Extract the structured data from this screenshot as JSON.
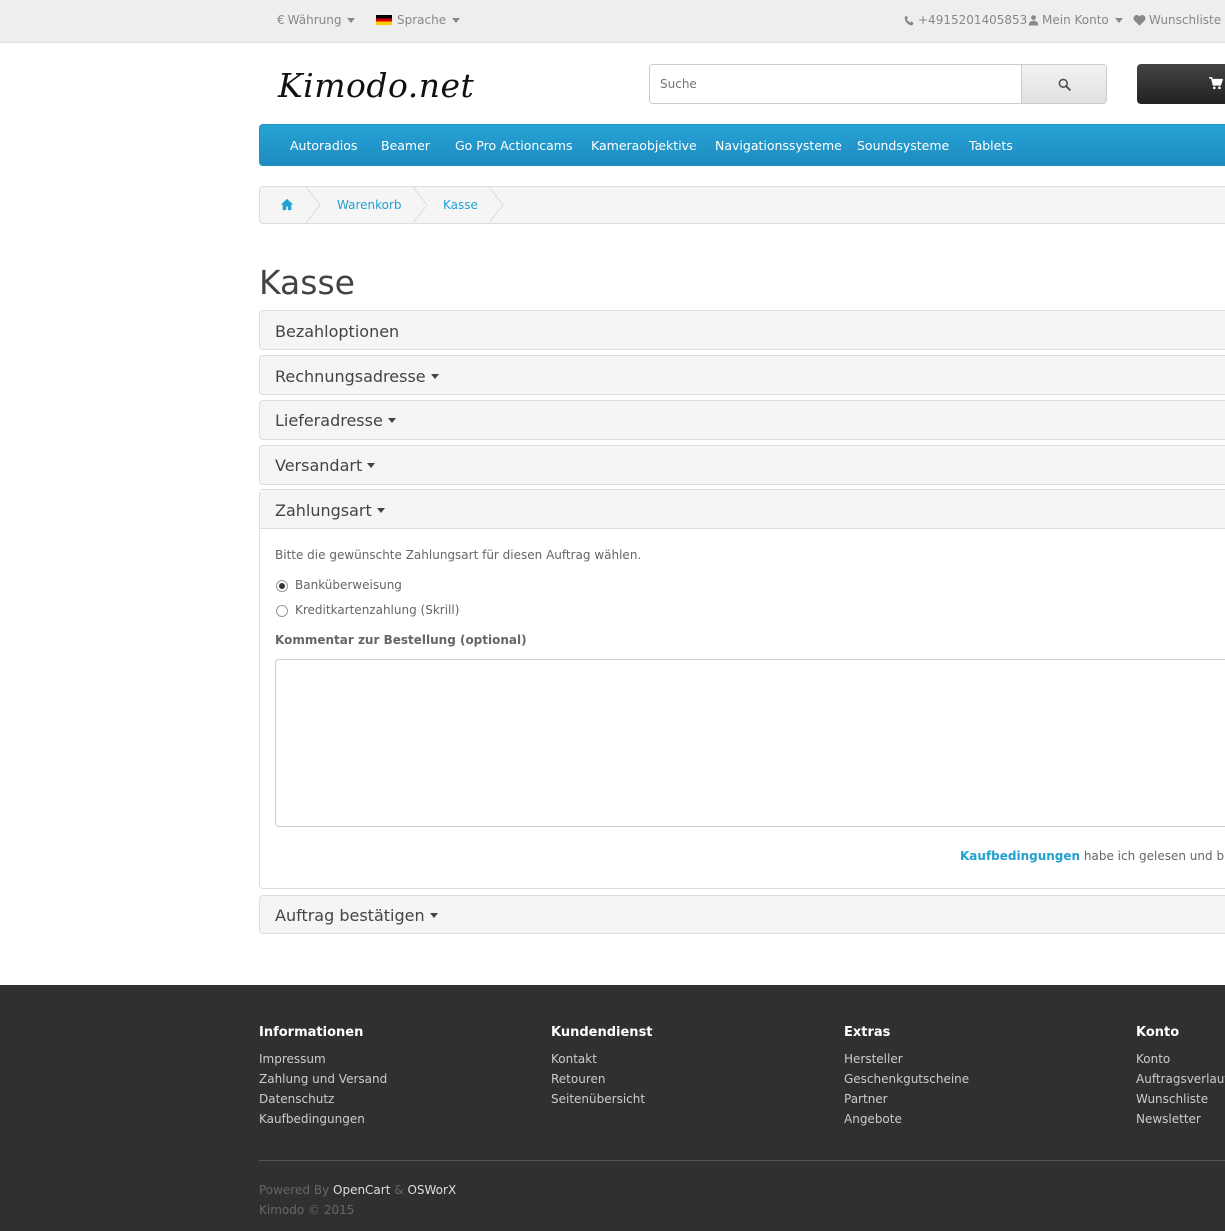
{
  "topbar": {
    "currency_label": "Währung",
    "currency_symbol": "€",
    "language_label": "Sprache",
    "phone": "+4915201405853",
    "account_label": "Mein Konto",
    "wishlist_label": "Wunschliste ("
  },
  "header": {
    "logo_text": "Kimodo.net",
    "search_placeholder": "Suche"
  },
  "menu": {
    "items": [
      "Autoradios",
      "Beamer",
      "Go Pro Actioncams",
      "Kameraobjektive",
      "Navigationssysteme",
      "Soundsysteme",
      "Tablets"
    ]
  },
  "breadcrumb": {
    "items": [
      "Warenkorb",
      "Kasse"
    ]
  },
  "page": {
    "title": "Kasse"
  },
  "checkout": {
    "panels": [
      "Bezahloptionen",
      "Rechnungsadresse",
      "Lieferadresse",
      "Versandart",
      "Zahlungsart",
      "Auftrag bestätigen"
    ],
    "payment": {
      "intro": "Bitte die gewünschte Zahlungsart für diesen Auftrag wählen.",
      "options": [
        "Banküberweisung",
        "Kreditkartenzahlung (Skrill)"
      ],
      "selected_index": 0,
      "comment_label": "Kommentar zur Bestellung (optional)",
      "comment_value": "",
      "terms_link": "Kaufbedingungen",
      "terms_text": " habe ich gelesen und bin ein"
    }
  },
  "footer": {
    "columns": [
      {
        "title": "Informationen",
        "links": [
          "Impressum",
          "Zahlung und Versand",
          "Datenschutz",
          "Kaufbedingungen"
        ]
      },
      {
        "title": "Kundendienst",
        "links": [
          "Kontakt",
          "Retouren",
          "Seitenübersicht"
        ]
      },
      {
        "title": "Extras",
        "links": [
          "Hersteller",
          "Geschenkgutscheine",
          "Partner",
          "Angebote"
        ]
      },
      {
        "title": "Konto",
        "links": [
          "Konto",
          "Auftragsverlauf",
          "Wunschliste",
          "Newsletter"
        ]
      }
    ],
    "powered_prefix": "Powered By",
    "powered_opencart": "OpenCart",
    "powered_amp": "&",
    "powered_osworx": "OSWorX",
    "copyright": "Kimodo © 2015"
  }
}
